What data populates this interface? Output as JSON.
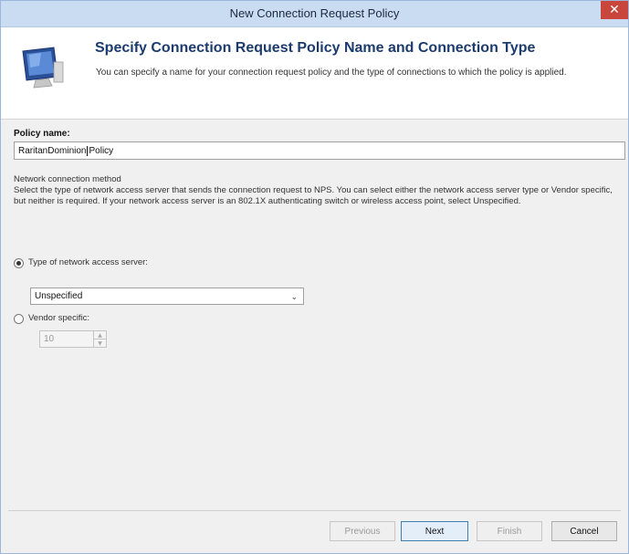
{
  "window": {
    "title": "New Connection Request Policy"
  },
  "header": {
    "heading": "Specify Connection Request Policy Name and Connection Type",
    "subheading": "You can specify a name for your connection request policy and the type of connections to which the policy is applied."
  },
  "policy_name": {
    "label": "Policy name:",
    "value_before": "RaritanDominion",
    "value_after": "Policy"
  },
  "network_method": {
    "title": "Network connection method",
    "description": "Select the type of network access server that sends the connection request to NPS. You can select either the network access server type or Vendor specific, but neither is required.  If your network access server is an 802.1X authenticating switch or wireless access point, select Unspecified."
  },
  "options": {
    "type_label": "Type of network access server:",
    "type_selected": true,
    "type_value": "Unspecified",
    "vendor_label": "Vendor specific:",
    "vendor_selected": false,
    "vendor_value": "10"
  },
  "buttons": {
    "previous": "Previous",
    "next": "Next",
    "finish": "Finish",
    "cancel": "Cancel"
  }
}
